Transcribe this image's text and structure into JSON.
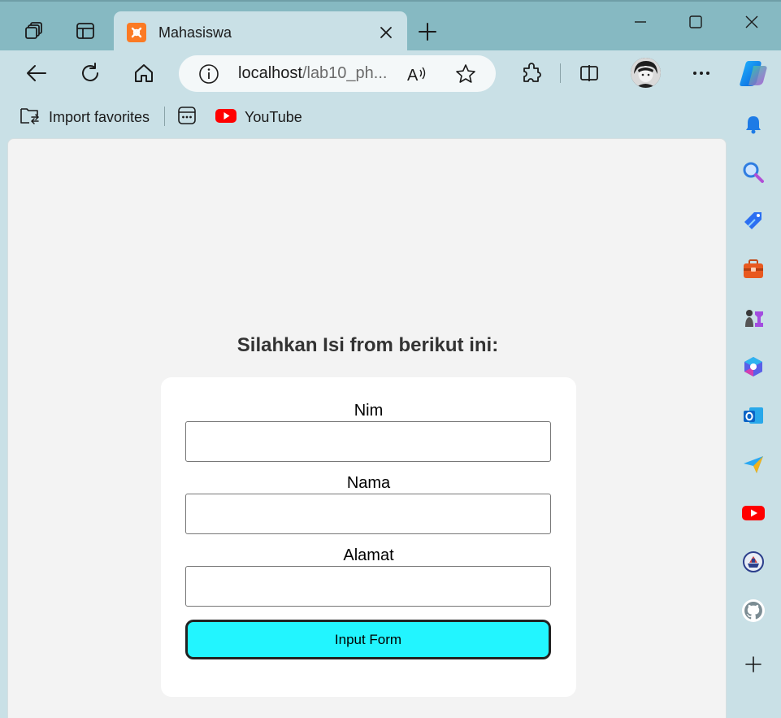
{
  "browser": {
    "tab_title": "Mahasiswa",
    "address_host": "localhost",
    "address_path": "/lab10_ph...",
    "read_aloud_label": "A",
    "favorites": [
      {
        "label": "Import favorites"
      },
      {
        "label": ""
      },
      {
        "label": "YouTube"
      }
    ]
  },
  "page": {
    "heading": "Silahkan Isi from berikut ini:",
    "fields": [
      {
        "label": "Nim",
        "value": ""
      },
      {
        "label": "Nama",
        "value": ""
      },
      {
        "label": "Alamat",
        "value": ""
      }
    ],
    "submit_label": "Input Form"
  },
  "colors": {
    "titlebar": "#86b9c2",
    "chrome": "#c9e0e6",
    "submit_button": "#22f5ff",
    "favicon": "#fb7a24"
  }
}
